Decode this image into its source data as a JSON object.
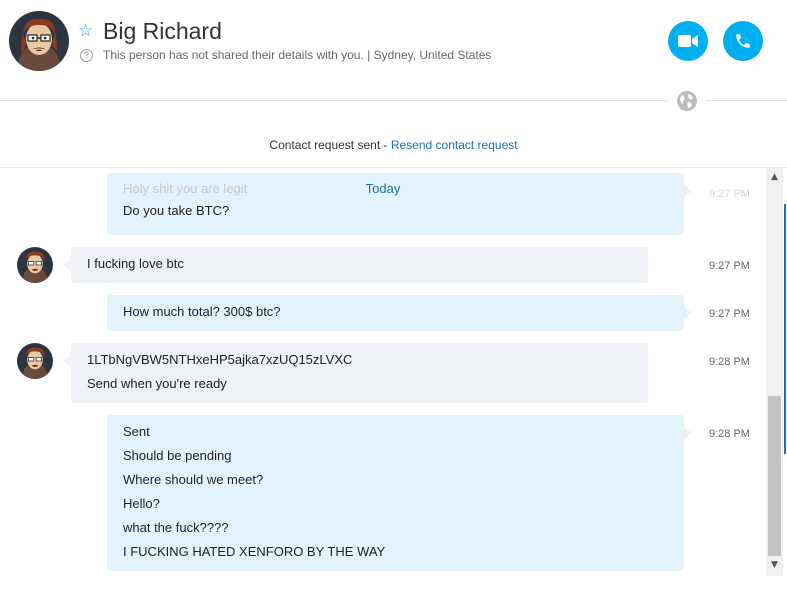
{
  "header": {
    "name": "Big Richard",
    "details": "This person has not shared their details with you.  |  Sydney, United States",
    "help_glyph": "?",
    "star_glyph": "☆"
  },
  "request": {
    "text": "Contact request sent - ",
    "link": "Resend contact request"
  },
  "chat": {
    "day_label": "Today",
    "messages": [
      {
        "direction": "out",
        "lines": [
          "Holy shit you are legit",
          "Do you take BTC?"
        ],
        "time": "9:27 PM"
      },
      {
        "direction": "in",
        "lines": [
          "I fucking love btc"
        ],
        "time": "9:27 PM"
      },
      {
        "direction": "out",
        "lines": [
          "How much total? 300$ btc?"
        ],
        "time": "9:27 PM"
      },
      {
        "direction": "in",
        "lines": [
          "1LTbNgVBW5NTHxeHP5ajka7xzUQ15zLVXC",
          "Send when you're ready"
        ],
        "time": "9:28 PM"
      },
      {
        "direction": "out",
        "lines": [
          "Sent",
          "Should be pending",
          "Where should we meet?",
          "Hello?",
          "what the fuck????",
          "I FUCKING HATED XENFORO BY THE WAY"
        ],
        "time": "9:28 PM"
      }
    ]
  },
  "scroll": {
    "up_glyph": "▲",
    "down_glyph": "▼"
  },
  "colors": {
    "accent": "#00aff0",
    "link": "#1a6fa8",
    "in_bubble": "#eef1f6",
    "out_bubble": "#e3f3fb"
  }
}
